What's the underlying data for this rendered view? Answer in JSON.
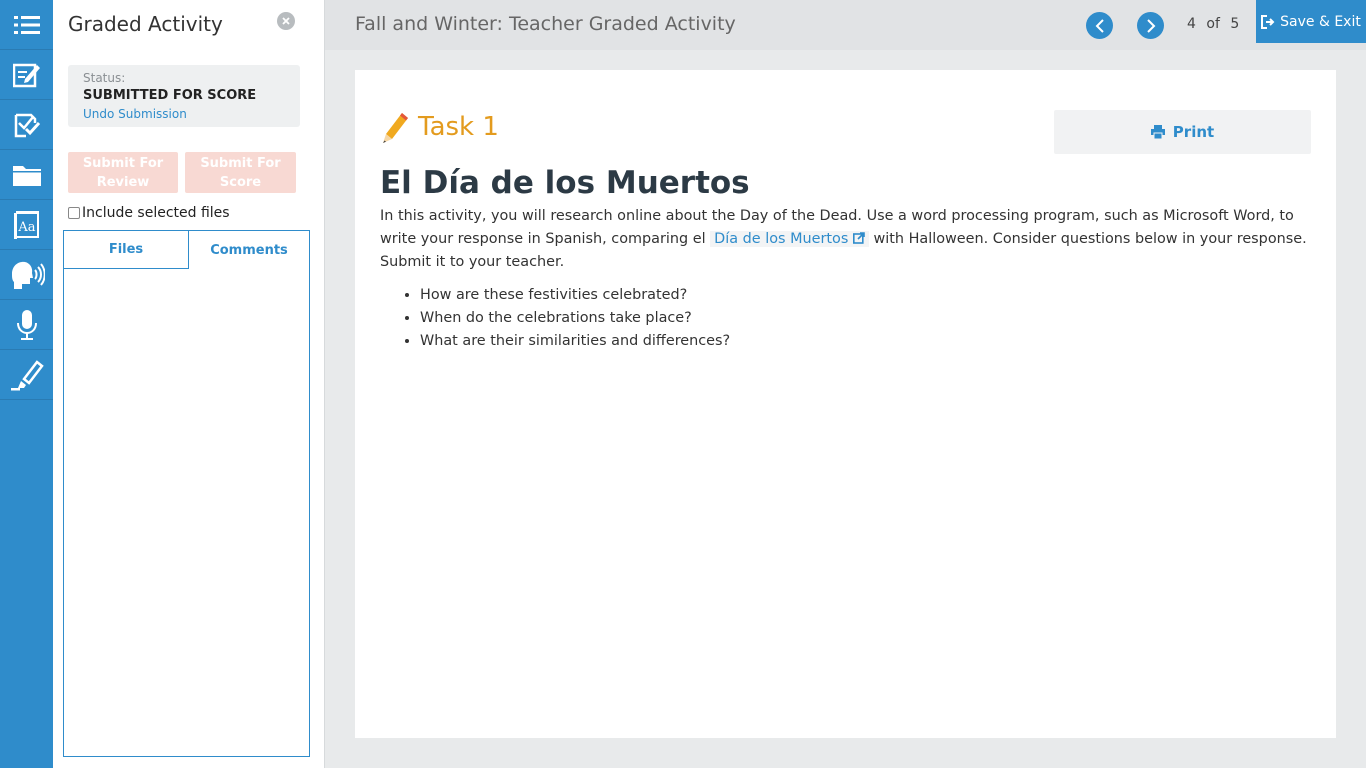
{
  "panel": {
    "title": "Graded Activity",
    "status_label": "Status:",
    "status_value": "SUBMITTED FOR SCORE",
    "undo_link": "Undo Submission",
    "submit_review": "Submit For Review",
    "submit_score": "Submit For Score",
    "include_files": "Include selected files",
    "tabs": [
      {
        "label": "Files"
      },
      {
        "label": "Comments"
      }
    ]
  },
  "header": {
    "course_title": "Fall and Winter: Teacher Graded Activity",
    "current_page": "4",
    "of_label": "of",
    "total_pages": "5",
    "save_exit": "Save & Exit"
  },
  "content": {
    "task_label": "Task 1",
    "print_label": "Print",
    "heading": "El Día de los Muertos",
    "para_before": "In this activity, you will research online about the Day of the Dead. Use a word processing program, such as Microsoft Word, to write your response in Spanish, comparing el",
    "link_text": "Día de los Muertos",
    "para_after": "with Halloween. Consider questions below in your response. Submit it to your teacher.",
    "bullets": [
      "How are these festivities celebrated?",
      "When do the celebrations take place?",
      "What are their similarities and differences?"
    ]
  },
  "colors": {
    "primary": "#2f8ccb",
    "task_orange": "#e39b1e",
    "disabled_button": "#f8d9d3"
  },
  "rail_icons": [
    "list-icon",
    "edit-notes-icon",
    "graded-check-icon",
    "folder-icon",
    "dictionary-icon",
    "speech-icon",
    "microphone-icon",
    "highlighter-icon"
  ]
}
